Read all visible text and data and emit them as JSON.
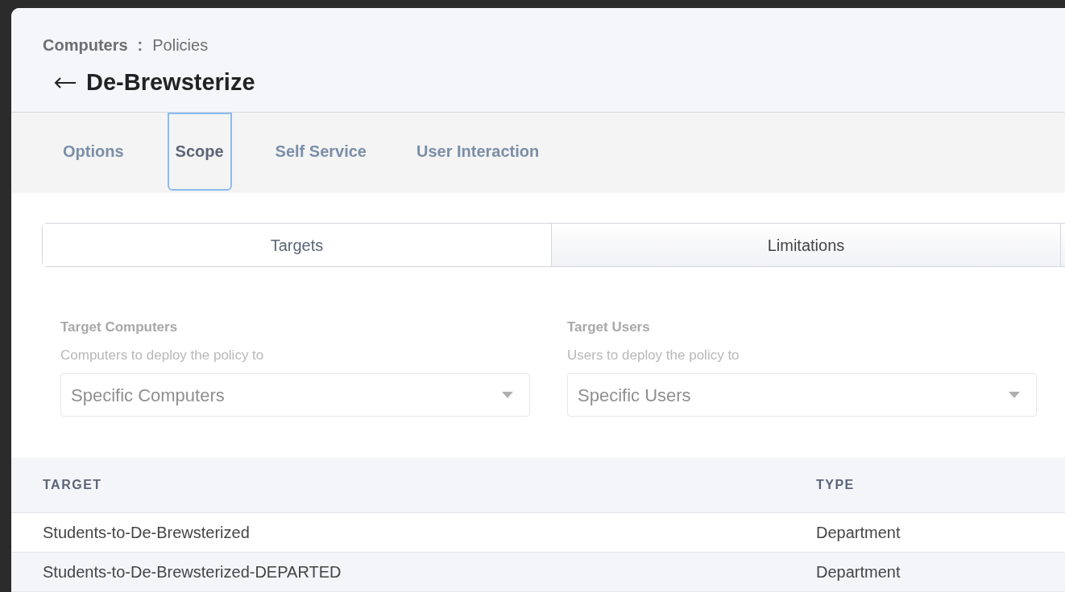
{
  "breadcrumb": {
    "section": "Computers",
    "separator": ":",
    "page": "Policies"
  },
  "title": "De-Brewsterize",
  "tabs": [
    {
      "label": "Options",
      "selected": false
    },
    {
      "label": "Scope",
      "selected": true
    },
    {
      "label": "Self Service",
      "selected": false
    },
    {
      "label": "User Interaction",
      "selected": false
    }
  ],
  "segments": [
    {
      "label": "Targets",
      "selected": true
    },
    {
      "label": "Limitations",
      "selected": false
    }
  ],
  "selectors": [
    {
      "label": "Target Computers",
      "description": "Computers to deploy the policy to",
      "value": "Specific Computers",
      "disabled": true
    },
    {
      "label": "Target Users",
      "description": "Users to deploy the policy to",
      "value": "Specific Users",
      "disabled": true
    }
  ],
  "table": {
    "columns": [
      "TARGET",
      "TYPE"
    ],
    "rows": [
      [
        "Students-to-De-Brewsterized",
        "Department"
      ],
      [
        "Students-to-De-Brewsterized-DEPARTED",
        "Department"
      ]
    ]
  }
}
